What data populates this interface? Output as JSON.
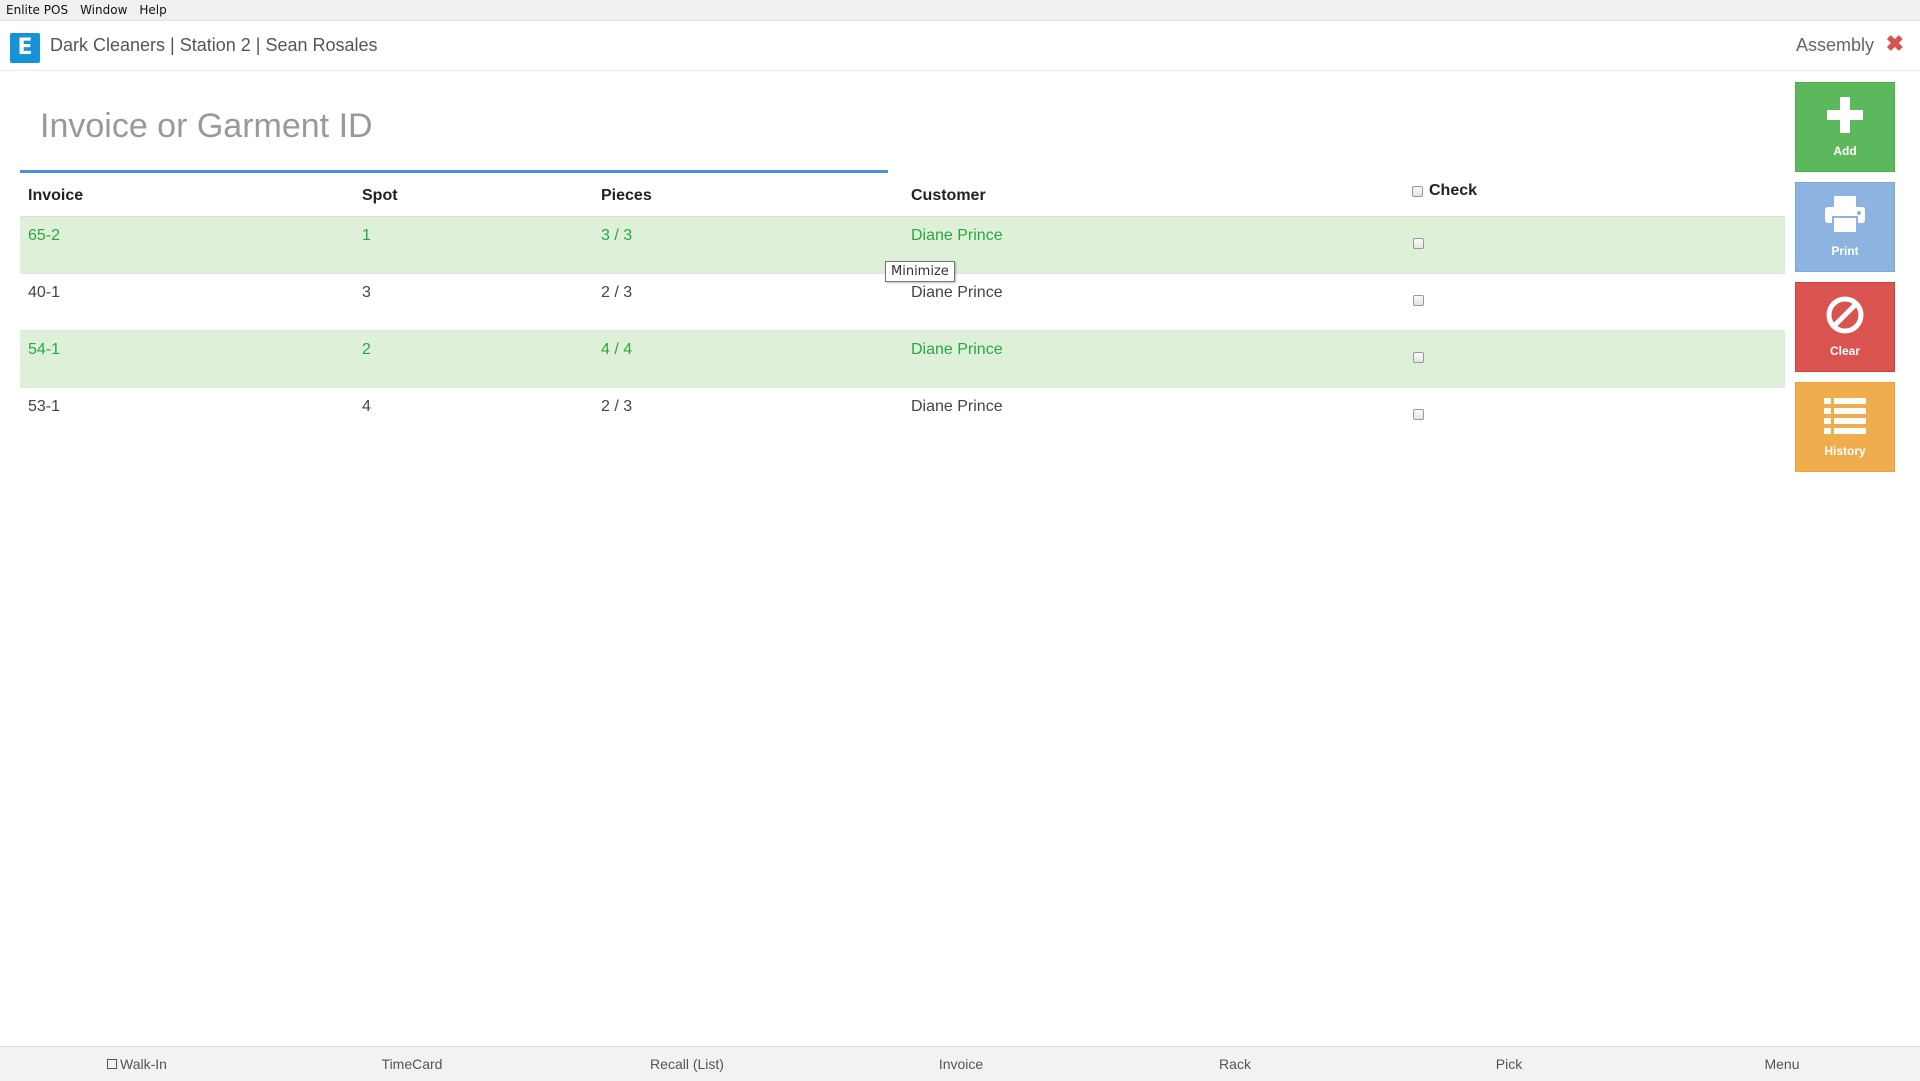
{
  "menubar": {
    "items": [
      "Enlite POS",
      "Window",
      "Help"
    ]
  },
  "header": {
    "logo_letter": "E",
    "title": "Dark Cleaners | Station 2 | Sean Rosales",
    "module": "Assembly",
    "close_glyph": "✖"
  },
  "search": {
    "placeholder": "Invoice or Garment ID",
    "value": ""
  },
  "table": {
    "columns": {
      "invoice": "Invoice",
      "spot": "Spot",
      "pieces": "Pieces",
      "customer": "Customer",
      "check": "Check"
    },
    "rows": [
      {
        "invoice": "65-2",
        "spot": "1",
        "pieces": "3 / 3",
        "customer": "Diane Prince",
        "complete": true,
        "checked": false
      },
      {
        "invoice": "40-1",
        "spot": "3",
        "pieces": "2 / 3",
        "customer": "Diane Prince",
        "complete": false,
        "checked": false
      },
      {
        "invoice": "54-1",
        "spot": "2",
        "pieces": "4 / 4",
        "customer": "Diane Prince",
        "complete": true,
        "checked": false
      },
      {
        "invoice": "53-1",
        "spot": "4",
        "pieces": "2 / 3",
        "customer": "Diane Prince",
        "complete": false,
        "checked": false
      }
    ]
  },
  "tooltip": {
    "text": "Minimize"
  },
  "actions": {
    "add": {
      "label": "Add",
      "icon": "plus-icon",
      "color": "#5cb85c"
    },
    "print": {
      "label": "Print",
      "icon": "printer-icon",
      "color": "#8db4e0"
    },
    "clear": {
      "label": "Clear",
      "icon": "ban-icon",
      "color": "#d9534f"
    },
    "history": {
      "label": "History",
      "icon": "list-icon",
      "color": "#f0ad4e"
    }
  },
  "footer": {
    "items": [
      "Walk-In",
      "TimeCard",
      "Recall (List)",
      "Invoice",
      "Rack",
      "Pick",
      "Menu"
    ]
  },
  "colors": {
    "accent": "#4a90e2",
    "brand": "#1593d6",
    "complete_row_bg": "#dff0d8",
    "complete_text": "#28a745"
  }
}
